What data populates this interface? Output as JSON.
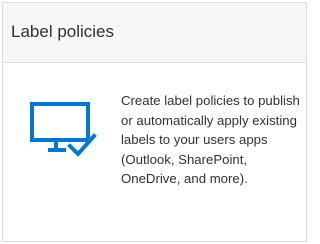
{
  "card": {
    "title": "Label policies",
    "description": "Create label policies to publish or automatically apply existing labels to your users apps (Outlook, SharePoint, OneDrive, and more).",
    "icon": "monitor-check-icon",
    "icon_color": "#0078d4"
  }
}
